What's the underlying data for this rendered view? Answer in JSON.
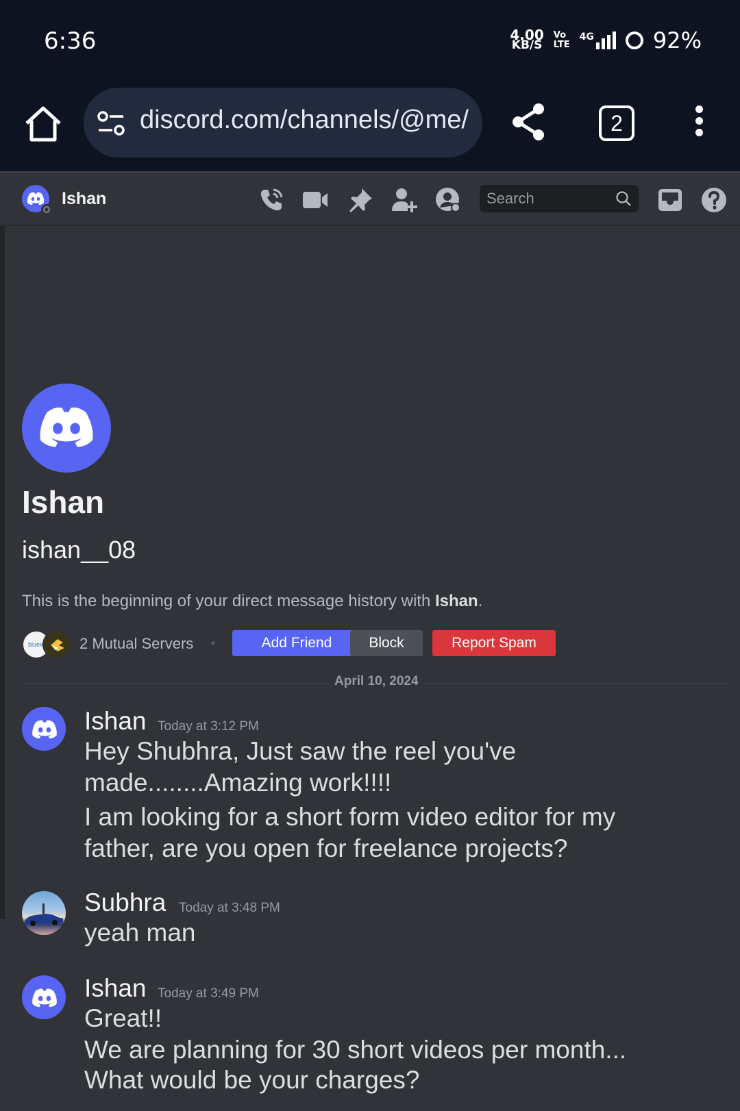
{
  "status_bar": {
    "time": "6:36",
    "net_speed_value": "4.00",
    "net_speed_unit": "KB/S",
    "volte_top": "Vo",
    "volte_bottom": "LTE",
    "network": "4G",
    "battery": "92%"
  },
  "browser": {
    "url": "discord.com/channels/@me/",
    "tab_count": "2"
  },
  "header": {
    "name": "Ishan",
    "search_placeholder": "Search"
  },
  "intro": {
    "name": "Ishan",
    "username": "ishan__08",
    "desc_prefix": "This is the beginning of your direct message history with ",
    "desc_name": "Ishan",
    "desc_suffix": ".",
    "server1_label": "bluele",
    "mutual_servers": "2 Mutual Servers",
    "add_friend": "Add Friend",
    "block": "Block",
    "report_spam": "Report Spam"
  },
  "date_divider": "April 10, 2024",
  "messages": [
    {
      "author": "Ishan",
      "time": "Today at 3:12 PM",
      "lines": [
        "Hey Shubhra, Just saw the reel you've",
        "made........Amazing work!!!!",
        "I am looking for a short form video editor for my",
        "father, are you open for freelance projects?"
      ]
    },
    {
      "author": "Subhra",
      "time": "Today at 3:48 PM",
      "lines": [
        "yeah man"
      ]
    },
    {
      "author": "Ishan",
      "time": "Today at 3:49 PM",
      "lines": [
        "Great!!",
        "We are planning for 30 short videos per month...",
        "What would be your charges?"
      ]
    }
  ],
  "colors": {
    "blurple": "#5865f2",
    "danger": "#da373c",
    "background": "#313338",
    "status_bar": "#0e1322"
  }
}
